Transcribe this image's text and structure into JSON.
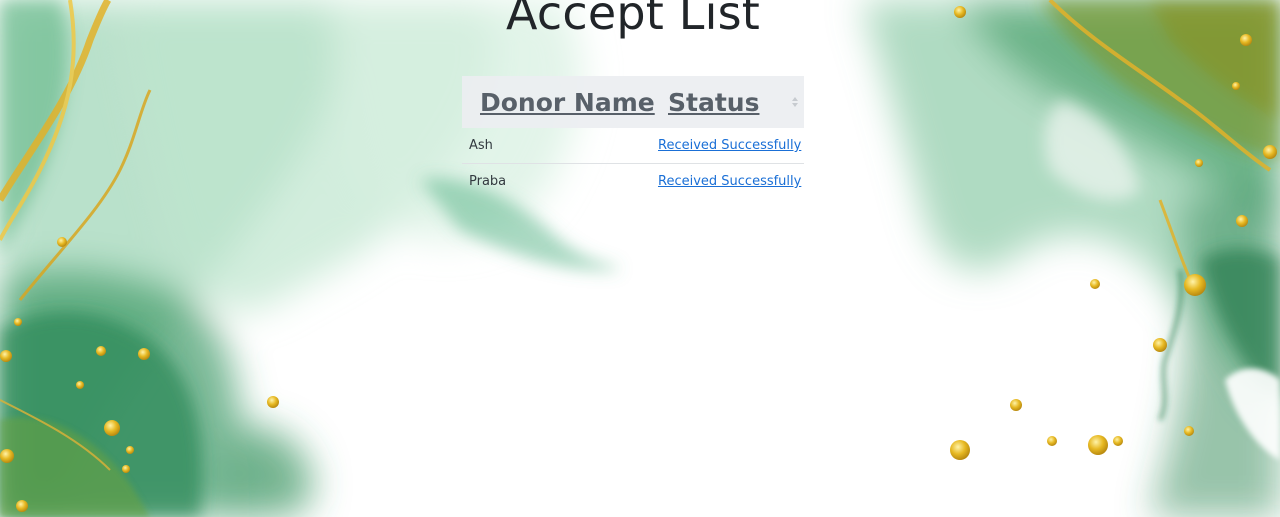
{
  "page": {
    "title": "Accept List"
  },
  "table": {
    "columns": [
      "Donor Name",
      "Status"
    ],
    "rows": [
      {
        "donor_name": "Ash",
        "status": "Received Successfully"
      },
      {
        "donor_name": "Praba",
        "status": "Received Successfully"
      }
    ]
  },
  "colors": {
    "title": "#212529",
    "header_bg": "#eceef1",
    "header_text": "#586069",
    "link": "#1a6fd6",
    "ink_green": "#2e8b57",
    "gold": "#e0b020"
  },
  "icons": {
    "sort": "sort-icon"
  }
}
